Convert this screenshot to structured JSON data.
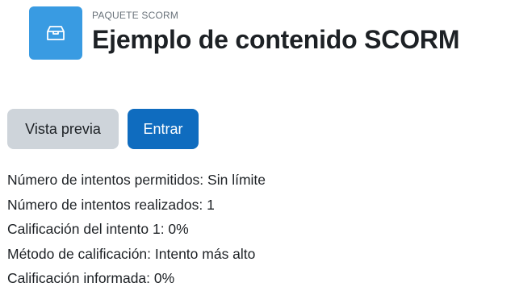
{
  "header": {
    "module_type": "PAQUETE SCORM",
    "title": "Ejemplo de contenido SCORM",
    "icon": "package-box-icon",
    "icon_bg_color": "#399be2"
  },
  "actions": {
    "preview_label": "Vista previa",
    "enter_label": "Entrar",
    "primary_color": "#0f6cbf",
    "secondary_color": "#ced4da"
  },
  "info": [
    "Número de intentos permitidos: Sin límite",
    "Número de intentos realizados: 1",
    "Calificación del intento 1: 0%",
    "Método de calificación: Intento más alto",
    "Calificación informada: 0%"
  ]
}
